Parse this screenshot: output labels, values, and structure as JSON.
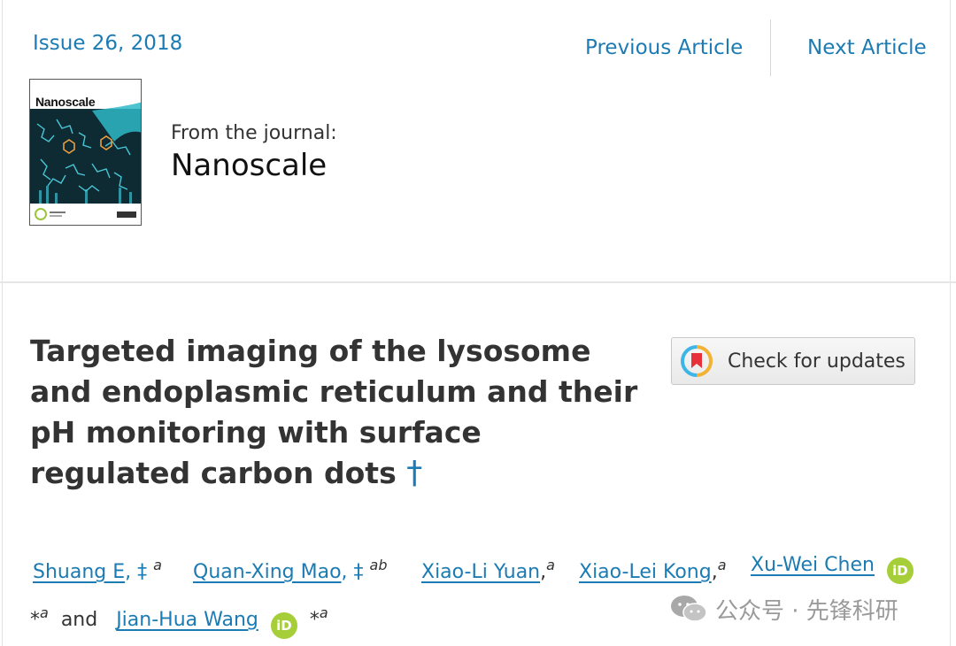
{
  "header": {
    "issue_link": "Issue 26, 2018",
    "previous_article": "Previous Article",
    "next_article": "Next Article"
  },
  "journal": {
    "cover_title": "Nanoscale",
    "from_label": "From the journal:",
    "name": "Nanoscale"
  },
  "article": {
    "title_lines": [
      "Targeted imaging of the lysosome",
      "and endoplasmic reticulum and their",
      "pH monitoring with surface",
      "regulated carbon dots"
    ],
    "title_dagger": "†",
    "check_updates_label": "Check for updates"
  },
  "authors": [
    {
      "name": "Shuang E",
      "marks": ", ‡",
      "affil": "a"
    },
    {
      "name": "Quan-Xing Mao",
      "marks": ", ‡",
      "affil": "ab"
    },
    {
      "name": "Xiao-Li Yuan",
      "marks": ",",
      "affil": "a"
    },
    {
      "name": "Xiao-Lei Kong",
      "marks": ",",
      "affil": "a"
    },
    {
      "name": "Xu-Wei Chen",
      "marks": "",
      "affil": "",
      "orcid": "iD"
    },
    {
      "pre_marks": "*",
      "pre_affil": "a",
      "conj": "and"
    },
    {
      "name": "Jian-Hua Wang",
      "orcid": "iD",
      "marks": "*",
      "affil": "a"
    }
  ],
  "watermark": {
    "text": "公众号 · 先锋科研"
  },
  "colors": {
    "link": "#1c7bb3",
    "orcid": "#a6ce39",
    "title": "#333333"
  }
}
